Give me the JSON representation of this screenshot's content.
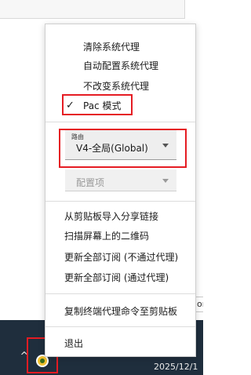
{
  "menu": {
    "items_top": [
      {
        "label": "清除系统代理",
        "checked": false
      },
      {
        "label": "自动配置系统代理",
        "checked": false
      },
      {
        "label": "不改变系统代理",
        "checked": false
      },
      {
        "label": "Pac 模式",
        "checked": true
      }
    ],
    "route": {
      "label": "路由",
      "value": "V4-全局(Global)"
    },
    "config": {
      "value": "配置项",
      "enabled": false
    },
    "items_mid": [
      {
        "label": "从剪贴板导入分享链接"
      },
      {
        "label": "扫描屏幕上的二维码"
      },
      {
        "label": "更新全部订阅 (不通过代理)"
      },
      {
        "label": "更新全部订阅 (通过代理)"
      }
    ],
    "copy_command": "复制终端代理命令至剪贴板",
    "exit": "退出"
  },
  "background": {
    "side_label": "on"
  },
  "taskbar": {
    "clock": "2025/12/1",
    "chevron": "^"
  },
  "colors": {
    "highlight_border": "#e51c23",
    "taskbar": "#1f2e3d",
    "app_icon": "#f2c230"
  },
  "icons": {
    "check": "check-icon",
    "overflow": "chevron-up-icon",
    "app": "v2rayn-tray-icon"
  }
}
